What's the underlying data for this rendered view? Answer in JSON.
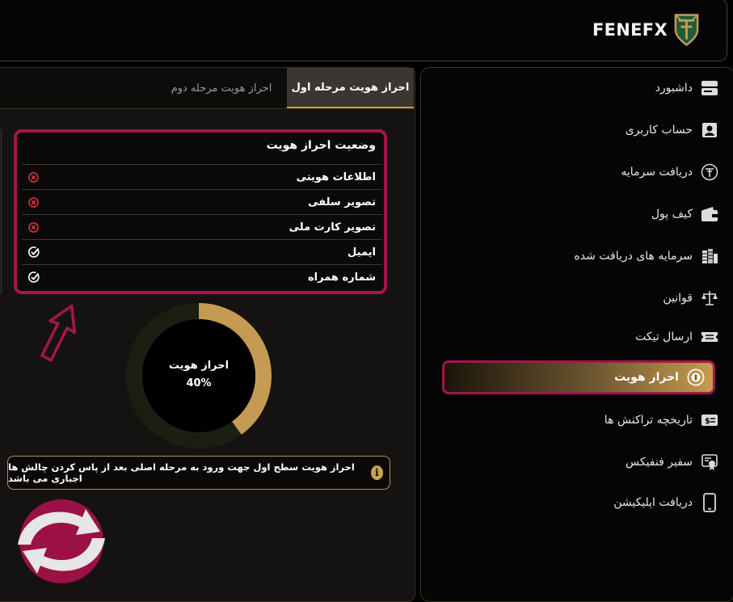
{
  "header": {
    "brand": "FENEFX"
  },
  "sidebar": {
    "items": [
      {
        "label": "داشبورد",
        "icon": "dashboard-icon"
      },
      {
        "label": "حساب کاربری",
        "icon": "user-account-icon"
      },
      {
        "label": "دریافت سرمایه",
        "icon": "capital-coin-icon"
      },
      {
        "label": "کیف پول",
        "icon": "wallet-icon"
      },
      {
        "label": "سرمایه های دریافت شده",
        "icon": "received-capital-icon"
      },
      {
        "label": "قوانین",
        "icon": "scales-icon"
      },
      {
        "label": "ارسال تیکت",
        "icon": "ticket-icon"
      },
      {
        "label": "احراز هویت",
        "icon": "identity-verify-icon",
        "active": true
      },
      {
        "label": "تاریخچه تراکنش ها",
        "icon": "transaction-history-icon"
      },
      {
        "label": "سفیر فنفیکس",
        "icon": "ambassador-icon"
      },
      {
        "label": "دریافت اپلیکیشن",
        "icon": "mobile-app-icon"
      }
    ]
  },
  "tabs": [
    {
      "label": "احراز هویت مرحله اول",
      "active": true
    },
    {
      "label": "احراز هویت مرحله دوم",
      "active": false
    }
  ],
  "status": {
    "title": "وضعیت احراز هویت",
    "rows": [
      {
        "label": "اطلاعات هویتی",
        "state": "incomplete"
      },
      {
        "label": "تصویر سلفی",
        "state": "incomplete"
      },
      {
        "label": "تصویر کارت ملی",
        "state": "incomplete"
      },
      {
        "label": "ایمیل",
        "state": "complete"
      },
      {
        "label": "شماره همراه",
        "state": "complete"
      }
    ]
  },
  "progress": {
    "label": "احراز هویت",
    "percent_text": "40%",
    "percent": 40
  },
  "note": {
    "text": "احراز هویت سطح اول جهت ورود به مرحله اصلی بعد از پاس کردن چالش ها اجباری می باشد"
  },
  "colors": {
    "accent": "#c59a52",
    "highlight": "#a5154e",
    "error": "#d9363e",
    "track": "#1a1f12"
  }
}
